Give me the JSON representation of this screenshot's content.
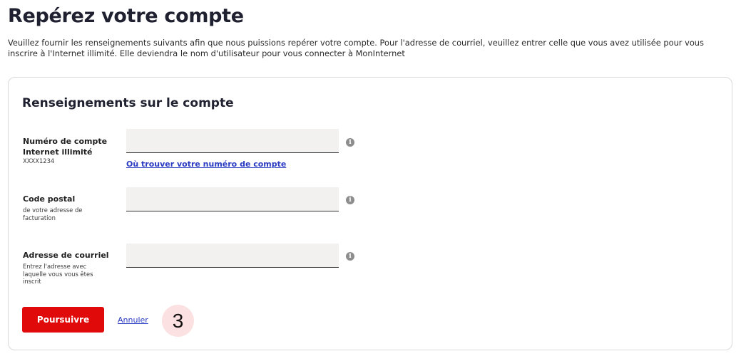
{
  "page": {
    "title": "Repérez votre compte",
    "intro": "Veuillez fournir les renseignements suivants afin que nous puissions repérer votre compte. Pour l'adresse de courriel, veuillez entrer celle que vous avez utilisée pour vous inscrire à l'Internet illimité. Elle deviendra le nom d'utilisateur pour vous connecter à MonInternet"
  },
  "card": {
    "title": "Renseignements sur le compte",
    "fields": [
      {
        "label": "Numéro de compte Internet illimité",
        "hint": "XXXX1234",
        "value": "",
        "placeholder": "",
        "info_icon": "info-icon",
        "help_link": "Où trouver votre numéro de compte"
      },
      {
        "label": "Code postal",
        "hint": "de votre adresse de facturation",
        "value": "",
        "placeholder": "",
        "info_icon": "info-icon"
      },
      {
        "label": "Adresse de courriel",
        "hint": "Entrez l'adresse avec laquelle vous vous êtes inscrit",
        "value": "",
        "placeholder": "",
        "info_icon": "info-icon"
      }
    ],
    "primary_button": "Poursuivre",
    "cancel_link": "Annuler",
    "step_badge": "3"
  },
  "colors": {
    "primary": "#e10a0a",
    "link": "#2b3bc2",
    "input_bg": "#f2f1f0",
    "badge_bg": "#fbe1e1"
  }
}
